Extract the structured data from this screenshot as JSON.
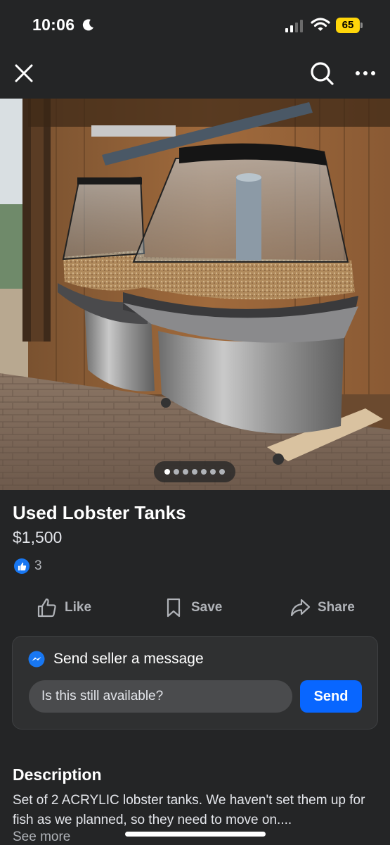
{
  "status_bar": {
    "time": "10:06",
    "battery_level": "65",
    "icons": [
      "moon-icon",
      "signal-icon",
      "wifi-icon",
      "battery-icon"
    ]
  },
  "nav": {
    "icons": [
      "close-icon",
      "search-icon",
      "more-icon"
    ]
  },
  "photo": {
    "carousel_total": 7,
    "carousel_active_index": 0
  },
  "listing": {
    "title": "Used Lobster Tanks",
    "price": "$1,500",
    "reaction_count": "3"
  },
  "actions": {
    "like": "Like",
    "save": "Save",
    "share": "Share"
  },
  "message": {
    "header": "Send seller a message",
    "input_value": "Is this still available?",
    "send": "Send"
  },
  "description": {
    "heading": "Description",
    "text": "Set of 2 ACRYLIC lobster tanks. We haven't set them up for fish as we planned, so they need to move on....",
    "see_more": "See more"
  },
  "colors": {
    "background": "#242526",
    "accent": "#0866ff",
    "like_blue": "#1877f2",
    "battery": "#ffd60a"
  }
}
